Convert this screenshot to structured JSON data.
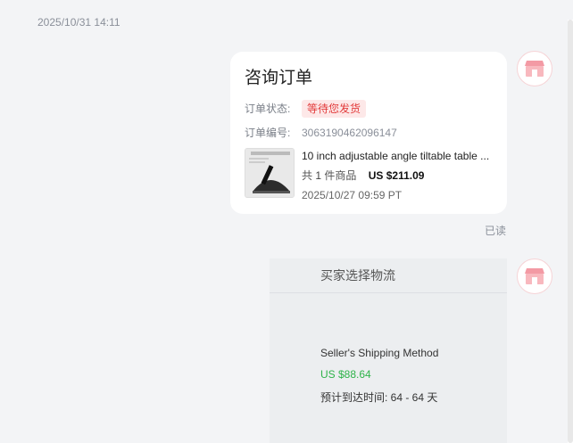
{
  "timestamp": "2025/10/31 14:11",
  "order_card": {
    "title": "咨询订单",
    "status_label": "订单状态:",
    "status_value": "等待您发货",
    "order_no_label": "订单编号:",
    "order_no_value": "3063190462096147",
    "product": {
      "name": "10 inch adjustable angle tiltable table ...",
      "qty_prefix": "共",
      "qty_value": "1",
      "qty_suffix": "件商品",
      "price": "US $211.09",
      "time": "2025/10/27 09:59 PT"
    }
  },
  "read_status": "已读",
  "shipping_card": {
    "title": "买家选择物流",
    "method_name": "Seller's Shipping Method",
    "price": "US $88.64",
    "eta": "预计到达时间: 64 - 64 天"
  },
  "colors": {
    "status_red": "#e23b3b",
    "price_green": "#2fb34a",
    "avatar_pink": "#f39aa4"
  },
  "icons": {
    "avatar": "shop-icon"
  }
}
